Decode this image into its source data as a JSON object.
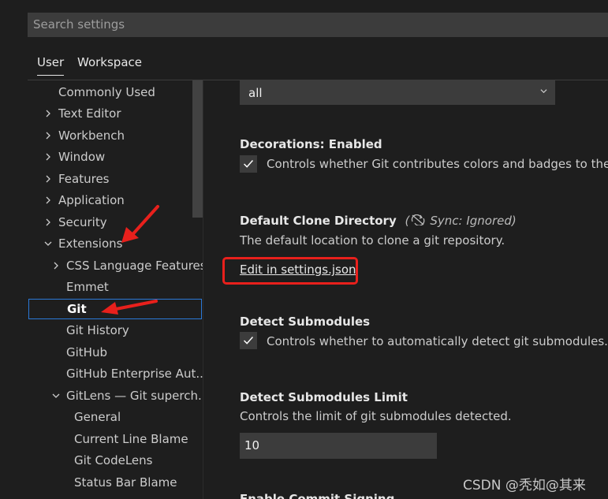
{
  "search": {
    "placeholder": "Search settings"
  },
  "tabs": {
    "user": "User",
    "workspace": "Workspace"
  },
  "tree": {
    "items": [
      {
        "label": "Commonly Used",
        "chevron": "",
        "depth": 0
      },
      {
        "label": "Text Editor",
        "chevron": "right",
        "depth": 0
      },
      {
        "label": "Workbench",
        "chevron": "right",
        "depth": 0
      },
      {
        "label": "Window",
        "chevron": "right",
        "depth": 0
      },
      {
        "label": "Features",
        "chevron": "right",
        "depth": 0
      },
      {
        "label": "Application",
        "chevron": "right",
        "depth": 0
      },
      {
        "label": "Security",
        "chevron": "right",
        "depth": 0
      },
      {
        "label": "Extensions",
        "chevron": "down",
        "depth": 0
      },
      {
        "label": "CSS Language Features",
        "chevron": "right",
        "depth": 1
      },
      {
        "label": "Emmet",
        "chevron": "",
        "depth": 1
      },
      {
        "label": "Git",
        "chevron": "",
        "depth": 1,
        "selected": true
      },
      {
        "label": "Git History",
        "chevron": "",
        "depth": 1
      },
      {
        "label": "GitHub",
        "chevron": "",
        "depth": 1
      },
      {
        "label": "GitHub Enterprise Aut...",
        "chevron": "",
        "depth": 1
      },
      {
        "label": "GitLens — Git superch...",
        "chevron": "down",
        "depth": 1
      },
      {
        "label": "General",
        "chevron": "",
        "depth": 2
      },
      {
        "label": "Current Line Blame",
        "chevron": "",
        "depth": 2
      },
      {
        "label": "Git CodeLens",
        "chevron": "",
        "depth": 2
      },
      {
        "label": "Status Bar Blame",
        "chevron": "",
        "depth": 2
      }
    ]
  },
  "settings": {
    "select_value": "all",
    "decorations": {
      "category": "Decorations: ",
      "name": "Enabled",
      "checked": true,
      "description": "Controls whether Git contributes colors and badges to the Ex"
    },
    "clone_dir": {
      "title": "Default Clone Directory",
      "sync": "Sync: Ignored)",
      "sync_open": "(",
      "description": "The default location to clone a git repository.",
      "link": "Edit in settings.json"
    },
    "submodules": {
      "title": "Detect Submodules",
      "checked": true,
      "description": "Controls whether to automatically detect git submodules."
    },
    "submodules_limit": {
      "title": "Detect Submodules Limit",
      "description": "Controls the limit of git submodules detected.",
      "value": "10"
    },
    "next_title": "Enable Commit Signing"
  },
  "watermark": "CSDN @秃如@其来",
  "colors": {
    "annotation_red": "#e8201c",
    "selection_border": "#2b79d8"
  }
}
